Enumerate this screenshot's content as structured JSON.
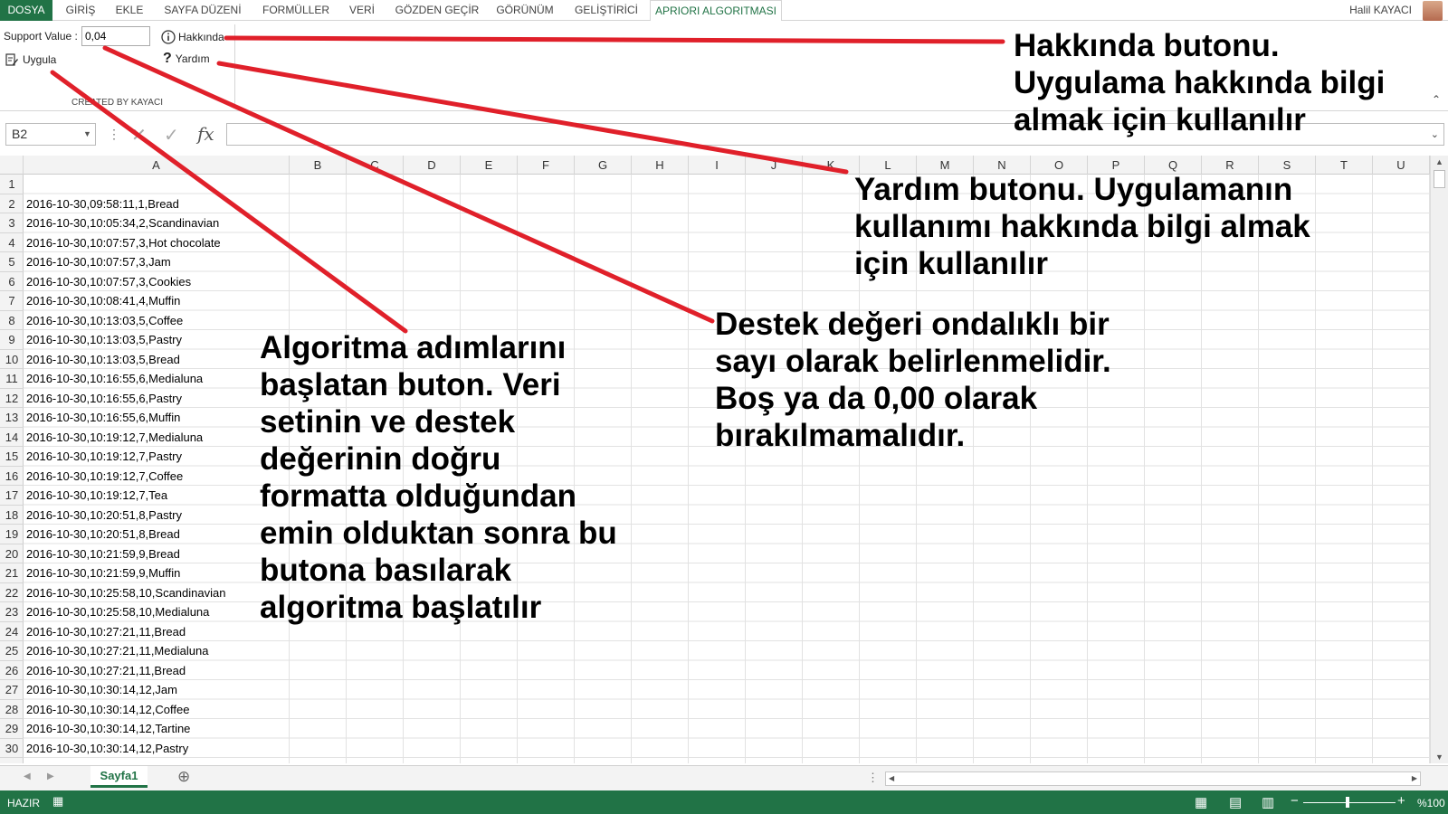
{
  "menu": {
    "file": "DOSYA",
    "tabs": [
      "GİRİŞ",
      "EKLE",
      "SAYFA DÜZENİ",
      "FORMÜLLER",
      "VERİ",
      "GÖZDEN GEÇİR",
      "GÖRÜNÜM",
      "GELİŞTİRİCİ"
    ],
    "active_tab": "APRIORI ALGORITMASI",
    "user": "Halil KAYACI"
  },
  "ribbon": {
    "support_label": "Support Value :",
    "support_value": "0,04",
    "apply_label": "Uygula",
    "about_label": "Hakkında",
    "help_label": "Yardım",
    "group_label": "CREATED BY KAYACI"
  },
  "formula": {
    "namebox": "B2",
    "content": ""
  },
  "columns": [
    "A",
    "B",
    "C",
    "D",
    "E",
    "F",
    "G",
    "H",
    "I",
    "J",
    "K",
    "L",
    "M",
    "N",
    "O",
    "P",
    "Q",
    "R",
    "S",
    "T",
    "U"
  ],
  "rows": [
    "1",
    "2",
    "3",
    "4",
    "5",
    "6",
    "7",
    "8",
    "9",
    "10",
    "11",
    "12",
    "13",
    "14",
    "15",
    "16",
    "17",
    "18",
    "19",
    "20",
    "21",
    "22",
    "23",
    "24",
    "25",
    "26",
    "27",
    "28",
    "29",
    "30"
  ],
  "cells": [
    "",
    "2016-10-30,09:58:11,1,Bread",
    "2016-10-30,10:05:34,2,Scandinavian",
    "2016-10-30,10:07:57,3,Hot chocolate",
    "2016-10-30,10:07:57,3,Jam",
    "2016-10-30,10:07:57,3,Cookies",
    "2016-10-30,10:08:41,4,Muffin",
    "2016-10-30,10:13:03,5,Coffee",
    "2016-10-30,10:13:03,5,Pastry",
    "2016-10-30,10:13:03,5,Bread",
    "2016-10-30,10:16:55,6,Medialuna",
    "2016-10-30,10:16:55,6,Pastry",
    "2016-10-30,10:16:55,6,Muffin",
    "2016-10-30,10:19:12,7,Medialuna",
    "2016-10-30,10:19:12,7,Pastry",
    "2016-10-30,10:19:12,7,Coffee",
    "2016-10-30,10:19:12,7,Tea",
    "2016-10-30,10:20:51,8,Pastry",
    "2016-10-30,10:20:51,8,Bread",
    "2016-10-30,10:21:59,9,Bread",
    "2016-10-30,10:21:59,9,Muffin",
    "2016-10-30,10:25:58,10,Scandinavian",
    "2016-10-30,10:25:58,10,Medialuna",
    "2016-10-30,10:27:21,11,Bread",
    "2016-10-30,10:27:21,11,Medialuna",
    "2016-10-30,10:27:21,11,Bread",
    "2016-10-30,10:30:14,12,Jam",
    "2016-10-30,10:30:14,12,Coffee",
    "2016-10-30,10:30:14,12,Tartine",
    "2016-10-30,10:30:14,12,Pastry"
  ],
  "sheet": {
    "tab": "Sayfa1"
  },
  "status": {
    "ready": "HAZIR",
    "zoom": "%100"
  },
  "annotations": {
    "about": [
      "Hakkında butonu.",
      "Uygulama hakkında bilgi",
      "almak için kullanılır"
    ],
    "help": [
      "Yardım butonu. Uygulamanın",
      "kullanımı hakkında bilgi almak",
      "için kullanılır"
    ],
    "support": [
      "Destek değeri ondalıklı bir",
      "sayı olarak belirlenmelidir.",
      "Boş ya da 0,00 olarak",
      "bırakılmamalıdır."
    ],
    "apply": [
      "Algoritma adımlarını",
      "başlatan buton. Veri",
      "setinin ve destek",
      "değerinin  doğru",
      "formatta olduğundan",
      "emin olduktan sonra bu",
      "butona basılarak",
      "algoritma başlatılır"
    ]
  },
  "colors": {
    "excel_green": "#217346",
    "arrow_red": "#e0202a"
  }
}
